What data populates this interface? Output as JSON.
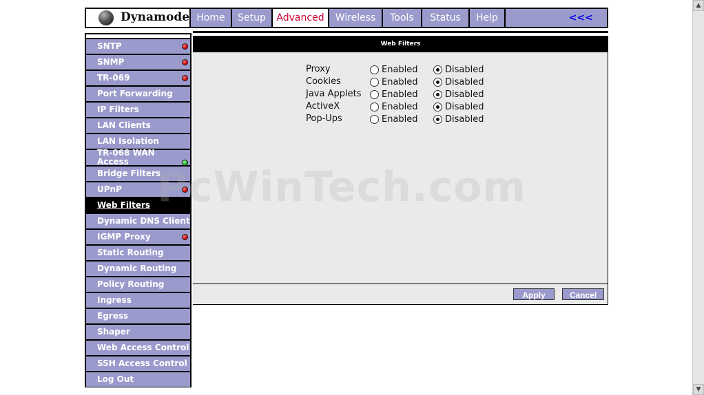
{
  "brand": {
    "name": "Dynamode"
  },
  "nav": {
    "tabs": [
      "Home",
      "Setup",
      "Advanced",
      "Wireless",
      "Tools",
      "Status",
      "Help"
    ],
    "active": "Advanced",
    "back_label": "<<<"
  },
  "sidebar": {
    "items": [
      {
        "label": "SNTP",
        "status": "red"
      },
      {
        "label": "SNMP",
        "status": "red"
      },
      {
        "label": "TR-069",
        "status": "red"
      },
      {
        "label": "Port Forwarding"
      },
      {
        "label": "IP Filters"
      },
      {
        "label": "LAN Clients"
      },
      {
        "label": "LAN Isolation"
      },
      {
        "label": "TR-068 WAN Access",
        "status": "green"
      },
      {
        "label": "Bridge Filters"
      },
      {
        "label": "UPnP",
        "status": "red"
      },
      {
        "label": "Web Filters",
        "active": true
      },
      {
        "label": "Dynamic DNS Client"
      },
      {
        "label": "IGMP Proxy",
        "status": "red"
      },
      {
        "label": "Static Routing"
      },
      {
        "label": "Dynamic Routing"
      },
      {
        "label": "Policy Routing"
      },
      {
        "label": "Ingress"
      },
      {
        "label": "Egress"
      },
      {
        "label": "Shaper"
      },
      {
        "label": "Web Access Control"
      },
      {
        "label": "SSH Access Control"
      },
      {
        "label": "Log Out"
      }
    ]
  },
  "main": {
    "title": "Web Filters",
    "filters": [
      {
        "label": "Proxy",
        "enabled": false
      },
      {
        "label": "Cookies",
        "enabled": false
      },
      {
        "label": "Java Applets",
        "enabled": false
      },
      {
        "label": "ActiveX",
        "enabled": false
      },
      {
        "label": "Pop-Ups",
        "enabled": false
      }
    ],
    "enabled_label": "Enabled",
    "disabled_label": "Disabled",
    "apply_label": "Apply",
    "cancel_label": "Cancel"
  },
  "watermark": "PcWinTech.com",
  "scrollbar": {
    "up_icon": "▲",
    "down_icon": "▼"
  },
  "colors": {
    "accent": "#9a9acc",
    "active_tab_text": "#cc0033",
    "back_link": "#0000ee",
    "content_bg": "#eaeaea"
  }
}
